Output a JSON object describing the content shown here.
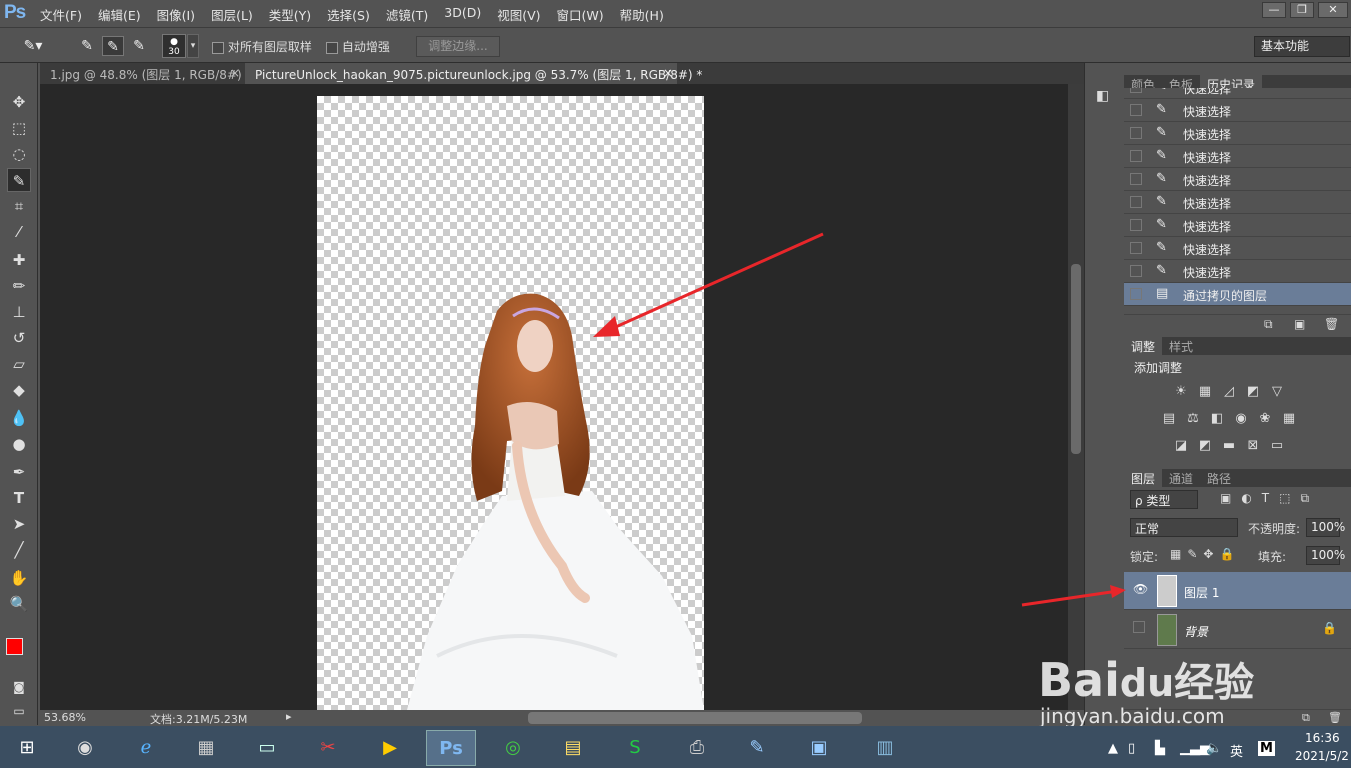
{
  "app": {
    "logo": "Ps",
    "accent": "#7fb7f0"
  },
  "menu": [
    "文件(F)",
    "编辑(E)",
    "图像(I)",
    "图层(L)",
    "类型(Y)",
    "选择(S)",
    "滤镜(T)",
    "3D(D)",
    "视图(V)",
    "窗口(W)",
    "帮助(H)"
  ],
  "window_buttons": [
    "—",
    "❐",
    "✕"
  ],
  "options": {
    "brush_size": "30",
    "sample_all_label": "对所有图层取样",
    "auto_enhance_label": "自动增强",
    "refine_edge_label": "调整边缘...",
    "workspace": "基本功能"
  },
  "tabs": [
    {
      "label": "1.jpg @ 48.8% (图层 1, RGB/8#)",
      "close": "×",
      "active": false
    },
    {
      "label": "PictureUnlock_haokan_9075.pictureunlock.jpg @ 53.7% (图层 1, RGB/8#) *",
      "close": "×",
      "active": true
    }
  ],
  "status": {
    "zoom": "53.68%",
    "doc": "文档:3.21M/5.23M"
  },
  "panel_tabs_top": [
    "颜色",
    "色板",
    "历史记录"
  ],
  "history": [
    {
      "icon": "quick-select-icon",
      "label": "快速选择"
    },
    {
      "icon": "quick-select-icon",
      "label": "快速选择"
    },
    {
      "icon": "quick-select-icon",
      "label": "快速选择"
    },
    {
      "icon": "quick-select-icon",
      "label": "快速选择"
    },
    {
      "icon": "quick-select-icon",
      "label": "快速选择"
    },
    {
      "icon": "quick-select-icon",
      "label": "快速选择"
    },
    {
      "icon": "quick-select-icon",
      "label": "快速选择"
    },
    {
      "icon": "quick-select-icon",
      "label": "快速选择"
    },
    {
      "icon": "quick-select-icon",
      "label": "快速选择"
    },
    {
      "icon": "document-icon",
      "label": "通过拷贝的图层",
      "selected": true
    }
  ],
  "panel_tabs_mid": [
    "调整",
    "样式"
  ],
  "adjust_title": "添加调整",
  "panel_tabs_layers": [
    "图层",
    "通道",
    "路径"
  ],
  "layers_panel": {
    "filter": "ρ 类型",
    "blend": "正常",
    "opacity_label": "不透明度:",
    "opacity": "100%",
    "lock_label": "锁定:",
    "fill_label": "填充:",
    "fill": "100%"
  },
  "layers": [
    {
      "name": "图层 1",
      "visible": true,
      "selected": true
    },
    {
      "name": "背景",
      "visible": false,
      "locked": true
    }
  ],
  "watermark": {
    "brand": "Bai",
    "paw": "du",
    "cn": "经验",
    "url": "jingyan.baidu.com"
  },
  "tray": {
    "ime": "英",
    "ime2": "M",
    "time": "16:36",
    "date": "2021/5/2"
  },
  "colors": {
    "foreground": "#ff0000",
    "background": "#1e6fd8",
    "arrow": "#e8262a",
    "selection": "#6a7d98"
  }
}
